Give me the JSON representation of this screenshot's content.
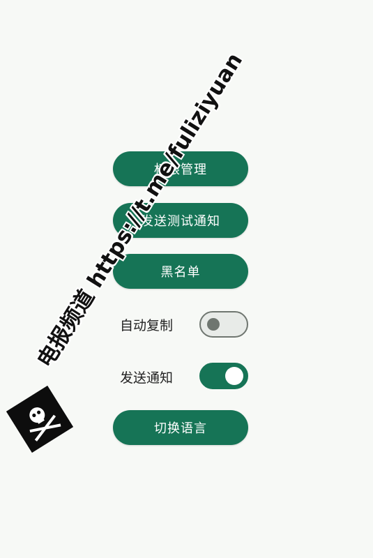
{
  "buttons": {
    "permissions": "权限管理",
    "send_test_notification": "发送测试通知",
    "blacklist": "黑名单",
    "switch_language": "切换语言"
  },
  "toggles": {
    "auto_copy": {
      "label": "自动复制",
      "state": "off"
    },
    "send_notification": {
      "label": "发送通知",
      "state": "on"
    }
  },
  "watermark": {
    "text": "电报频道 https://t.me/fuliziyuan",
    "logo_icon": "pirate-flag-icon"
  },
  "colors": {
    "accent": "#167456",
    "background": "#f7f9f6",
    "toggle_off_track": "#e8ebe8",
    "toggle_off_border": "#6f7670"
  }
}
